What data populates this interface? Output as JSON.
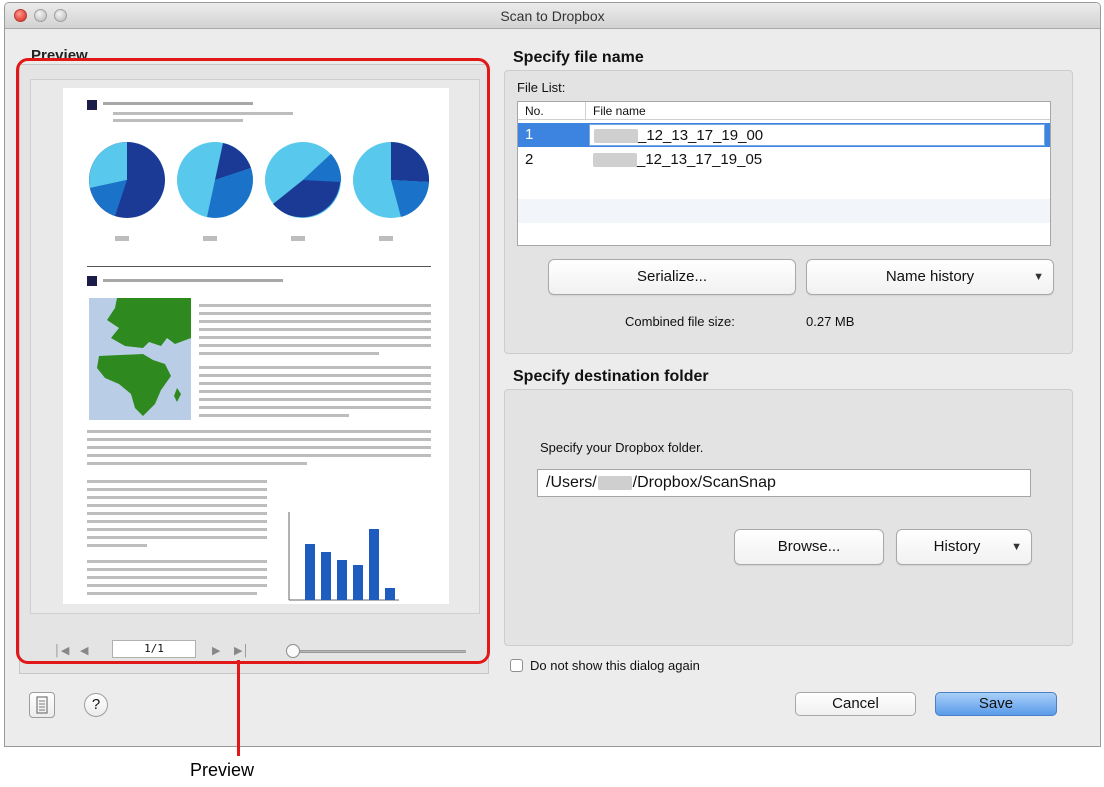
{
  "window": {
    "title": "Scan to Dropbox"
  },
  "preview": {
    "title": "Preview",
    "page_indicator": "1/1",
    "callout_label": "Preview",
    "slider_level": 0.0
  },
  "file_name": {
    "title": "Specify file name",
    "file_list_label": "File List:",
    "columns": [
      "No.",
      "File name"
    ],
    "rows": [
      {
        "no": "1",
        "name": "_12_13_17_19_00"
      },
      {
        "no": "2",
        "name": "_12_13_17_19_05"
      }
    ],
    "serialize_label": "Serialize...",
    "name_history_label": "Name history",
    "combined_size_label": "Combined file size:",
    "combined_size_value": "0.27  MB"
  },
  "destination": {
    "title": "Specify destination folder",
    "prompt": "Specify your Dropbox folder.",
    "path_prefix": "/Users/",
    "path_suffix": "/Dropbox/ScanSnap",
    "browse_label": "Browse...",
    "history_label": "History"
  },
  "footer": {
    "dont_show_label": "Do not show this dialog again",
    "cancel_label": "Cancel",
    "save_label": "Save",
    "help_label": "?"
  },
  "colors": {
    "selection": "#3d83e0",
    "callout": "#e21818",
    "save_button": "#5a9be9",
    "chart_bar": "#1f5cbf",
    "pie_light": "#58c8ec",
    "pie_mid": "#1a73c8",
    "pie_dark": "#1a3a96",
    "map_land": "#2e8a1e",
    "map_sea": "#b9cde6"
  }
}
